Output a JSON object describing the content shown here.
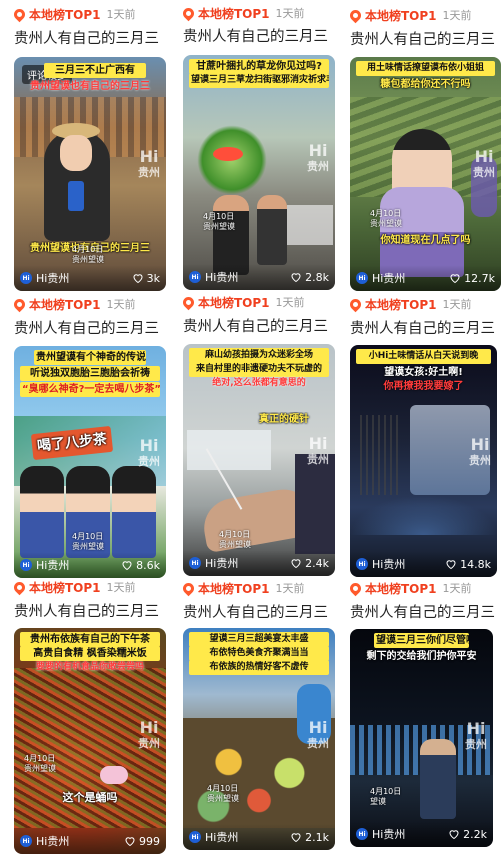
{
  "items": [
    {
      "tag": "本地榜TOP1",
      "time": "1天前",
      "title": "贵州人有自己的三月三",
      "overlay_label": "评论较多",
      "captions": [
        "三月三不止广西有",
        "贵州望谟也有自己的三月三"
      ],
      "bottom_caption": "贵州望谟也有自己的三月三",
      "watermark": "Hi",
      "watermark_sub": "贵州",
      "date_line1": "4月10日",
      "date_line2": "贵州望谟",
      "brand": "Hi贵州",
      "likes": "3k"
    },
    {
      "tag": "本地榜TOP1",
      "time": "1天前",
      "title": "贵州人有自己的三月三",
      "captions": [
        "甘蔗叶捆扎的草龙你见过吗?",
        "望谟三月三草龙扫街驱邪消灾祈求丰收"
      ],
      "watermark": "Hi",
      "watermark_sub": "贵州",
      "date_line1": "4月10日",
      "date_line2": "贵州望谟",
      "brand": "Hi贵州",
      "likes": "2.8k"
    },
    {
      "tag": "本地榜TOP1",
      "time": "1天前",
      "title": "贵州人有自己的三月三",
      "captions": [
        "用土味情话撩望谟布依小姐姐",
        "糠包都给你还不行吗"
      ],
      "bottom_caption": "你知道现在几点了吗",
      "watermark": "Hi",
      "watermark_sub": "贵州",
      "date_line1": "4月10日",
      "date_line2": "贵州望谟",
      "brand": "Hi贵州",
      "likes": "12.7k"
    },
    {
      "tag": "本地榜TOP1",
      "time": "1天前",
      "title": "贵州人有自己的三月三",
      "captions": [
        "贵州望谟有个神奇的传说",
        "听说独双胞胎三胞胎会祈祷",
        "“臭哪么神奇?一定去喝八步茶”"
      ],
      "banner_text": "喝了八步茶",
      "watermark": "Hi",
      "watermark_sub": "贵州",
      "date_line1": "4月10日",
      "date_line2": "贵州望谟",
      "brand": "Hi贵州",
      "likes": "8.6k"
    },
    {
      "tag": "本地榜TOP1",
      "time": "1天前",
      "title": "贵州人有自己的三月三",
      "captions": [
        "麻山幼孩拍摄为众迷彩全场",
        "来自村里的非遗硬功夫不玩虚的",
        "绝对,这么张都有意思的"
      ],
      "mid_caption": "真正的硬针",
      "watermark": "Hi",
      "watermark_sub": "贵州",
      "date_line1": "4月10日",
      "date_line2": "贵州望谟",
      "brand": "Hi贵州",
      "likes": "2.4k"
    },
    {
      "tag": "本地榜TOP1",
      "time": "1天前",
      "title": "贵州人有自己的三月三",
      "captions": [
        "小Hi土味情话从白天说到晚",
        "望谟女孩:好土啊!",
        "你再撩我我要嫁了"
      ],
      "watermark": "Hi",
      "watermark_sub": "贵州",
      "date_line1": "",
      "date_line2": "",
      "brand": "Hi贵州",
      "likes": "14.8k"
    },
    {
      "tag": "本地榜TOP1",
      "time": "1天前",
      "title": "贵州人有自己的三月三",
      "captions": [
        "贵州布依族有自己的下午茶",
        "高贵自食精 枫香染糯米饭",
        "要要的有机食品你敢尝尝吗"
      ],
      "mid_caption": "这个是蛹吗",
      "watermark": "Hi",
      "watermark_sub": "贵州",
      "date_line1": "4月10日",
      "date_line2": "贵州望谟",
      "brand": "Hi贵州",
      "likes": "999"
    },
    {
      "tag": "本地榜TOP1",
      "time": "1天前",
      "title": "贵州人有自己的三月三",
      "captions": [
        "望谟三月三超美宴太丰盛",
        "布依特色美食齐聚满当当",
        "布依族的热情好客不虚传"
      ],
      "watermark": "Hi",
      "watermark_sub": "贵州",
      "date_line1": "4月10日",
      "date_line2": "贵州望谟",
      "brand": "Hi贵州",
      "likes": "2.1k"
    },
    {
      "tag": "本地榜TOP1",
      "time": "1天前",
      "title": "贵州人有自己的三月三",
      "captions": [
        "望谟三月三你们尽管嗨",
        "剩下的交给我们护你平安"
      ],
      "watermark": "Hi",
      "watermark_sub": "贵州",
      "date_line1": "4月10日",
      "date_line2": "望谟",
      "brand": "Hi贵州",
      "likes": "2.2k"
    }
  ]
}
